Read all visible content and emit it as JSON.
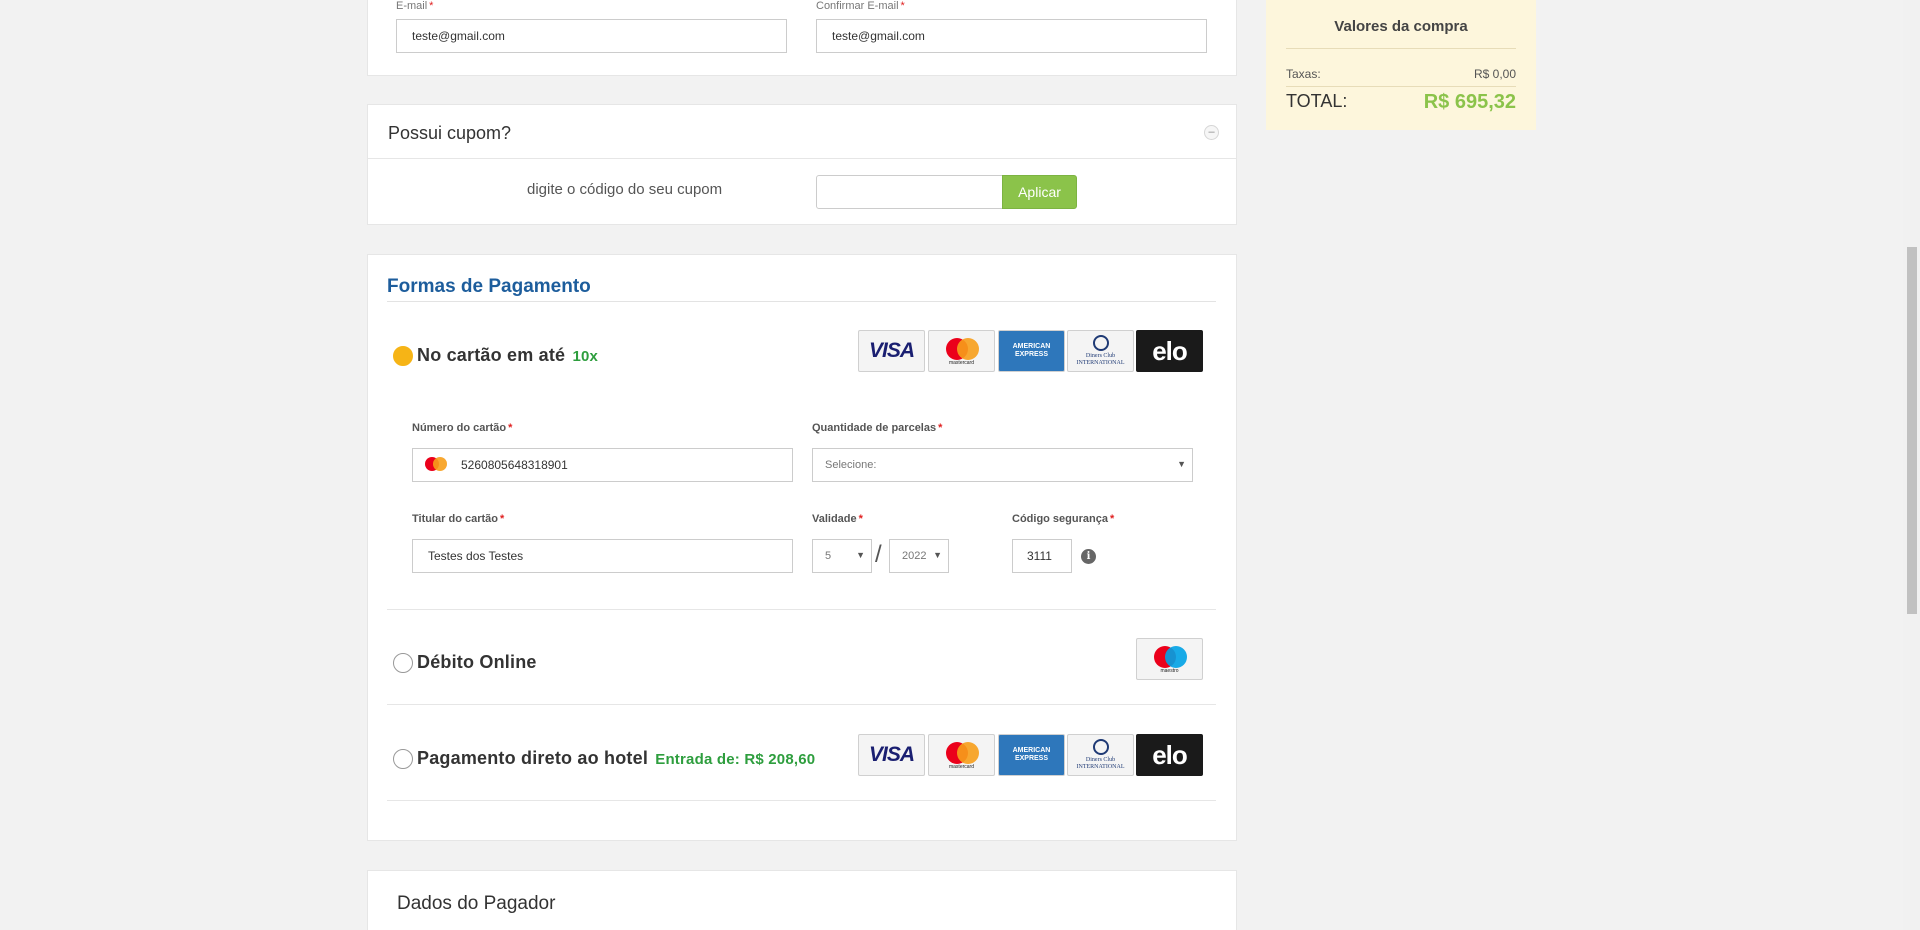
{
  "contact": {
    "email_label": "E-mail",
    "email_value": "teste@gmail.com",
    "confirm_email_label": "Confirmar E-mail",
    "confirm_email_value": "teste@gmail.com",
    "required_mark": "*"
  },
  "coupon": {
    "title": "Possui cupom?",
    "collapse_symbol": "–",
    "hint": "digite o código do seu cupom",
    "input_value": "",
    "apply_label": "Aplicar"
  },
  "payment": {
    "title": "Formas de Pagamento",
    "options": [
      {
        "label": "No cartão em até",
        "extra": "10x",
        "selected": true
      },
      {
        "label": "Débito Online",
        "extra": "",
        "selected": false
      },
      {
        "label": "Pagamento direto ao hotel",
        "extra": "Entrada de: R$ 208,60",
        "selected": false
      }
    ],
    "brands": {
      "visa": "VISA",
      "mastercard": "mastercard",
      "amex": "AMERICAN EXPRESS",
      "diners": "Diners Club INTERNATIONAL",
      "elo": "elo",
      "maestro": "maestro"
    },
    "card_form": {
      "number_label": "Número do cartão",
      "number_value": "5260805648318901",
      "installments_label": "Quantidade de parcelas",
      "installments_value": "Selecione:",
      "holder_label": "Titular do cartão",
      "holder_value": "Testes dos Testes",
      "validity_label": "Validade",
      "month_value": "5",
      "separator": "/",
      "year_value": "2022",
      "cvv_label": "Código segurança",
      "cvv_value": "3111",
      "info_symbol": "i"
    }
  },
  "payer": {
    "title": "Dados do Pagador"
  },
  "summary": {
    "title": "Valores da compra",
    "tax_label": "Taxas:",
    "tax_value": "R$ 0,00",
    "total_label": "TOTAL:",
    "total_value": "R$ 695,32"
  },
  "colors": {
    "accent_green": "#8bc34a",
    "payment_title_blue": "#1d5d9c",
    "selected_radio": "#f6b416",
    "summary_bg": "#fdf6dc"
  }
}
